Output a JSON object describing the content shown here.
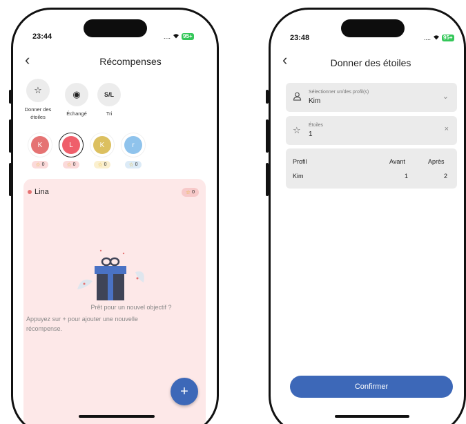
{
  "left": {
    "status": {
      "time": "23:44",
      "signal": "....",
      "battery": "95+"
    },
    "nav": {
      "back": "‹",
      "title": "Récompenses"
    },
    "actions": [
      {
        "icon": "☆",
        "label": "Donner des étoiles"
      },
      {
        "icon": "◉",
        "label": "Échangé"
      },
      {
        "icon": "S/L",
        "label": "Tri"
      }
    ],
    "avatars": [
      {
        "initial": "K",
        "color": "#e57373",
        "stars": "0",
        "pill_bg": "#fbdada"
      },
      {
        "initial": "L",
        "color": "#ef5f6b",
        "stars": "0",
        "pill_bg": "#fbdada"
      },
      {
        "initial": "K",
        "color": "#dcc060",
        "stars": "0",
        "pill_bg": "#fbf0cf"
      },
      {
        "initial": "r",
        "color": "#8fc3ec",
        "stars": "0",
        "pill_bg": "#dcebf7"
      }
    ],
    "card": {
      "name": "Lina",
      "stars": "0",
      "empty_title": "Prêt pour un nouvel objectif ?",
      "empty_body": "Appuyez sur + pour ajouter une nouvelle récompense."
    },
    "fab": "+"
  },
  "right": {
    "status": {
      "time": "23:48",
      "signal": "....",
      "battery": "95+"
    },
    "nav": {
      "back": "‹",
      "title": "Donner des étoiles"
    },
    "profile_field": {
      "label": "Sélectionner un/des profil(s)",
      "value": "Kim"
    },
    "stars_field": {
      "label": "Étoiles",
      "value": "1"
    },
    "table": {
      "headers": [
        "Profil",
        "Avant",
        "Après"
      ],
      "row": [
        "Kim",
        "1",
        "2"
      ]
    },
    "confirm_label": "Confirmer"
  },
  "colors": {
    "accent": "#3d68b8",
    "card_bg": "#fde8e8",
    "field_bg": "#ebebeb"
  }
}
